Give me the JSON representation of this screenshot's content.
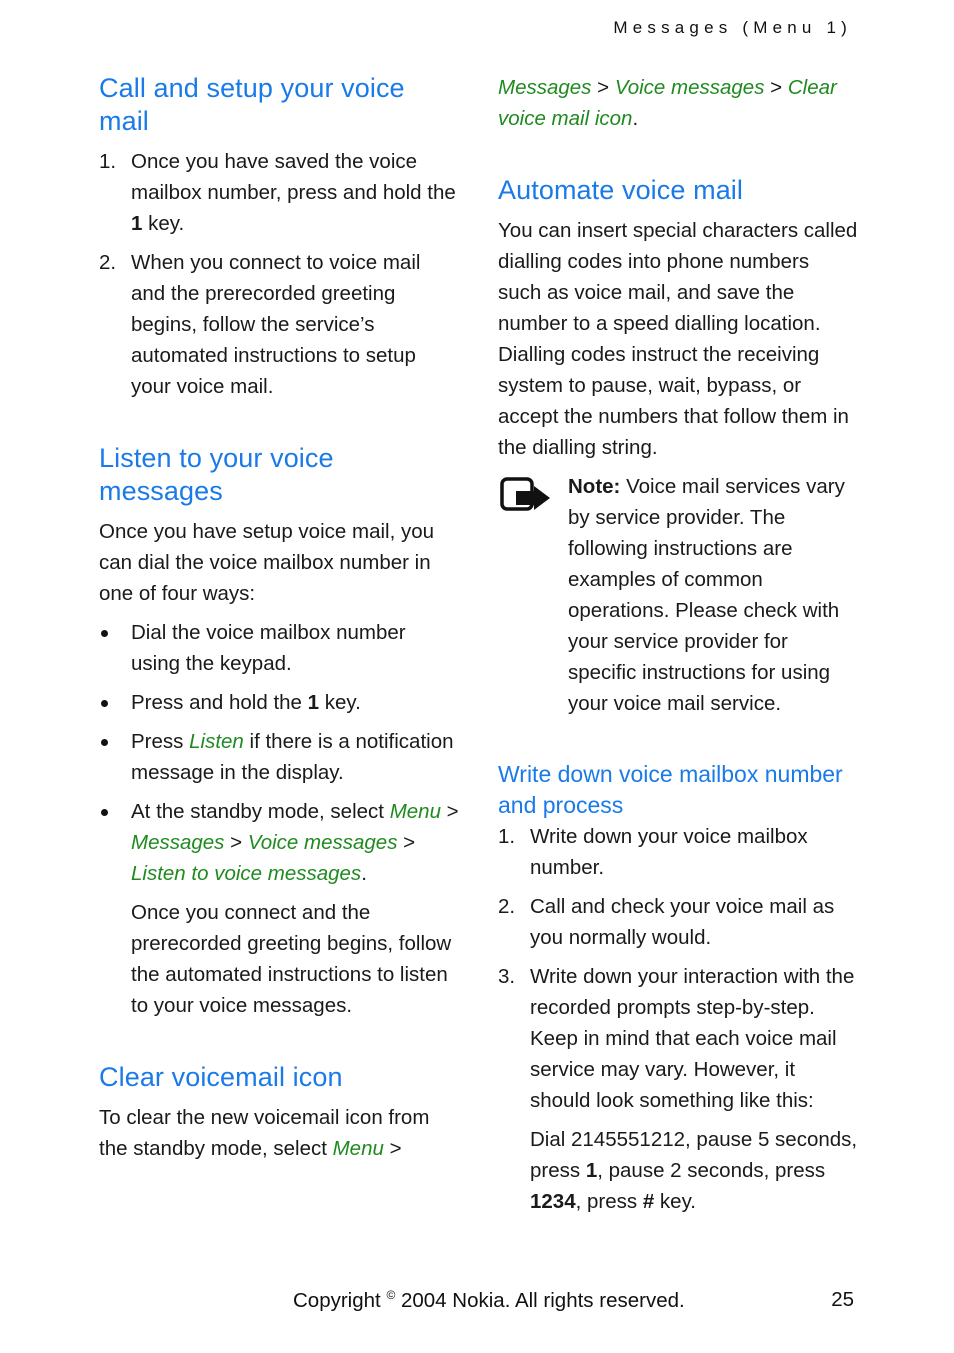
{
  "header": {
    "section": "Messages (Menu 1)"
  },
  "left": {
    "call_setup": {
      "title": "Call and setup your voice mail",
      "steps": [
        {
          "num": "1.",
          "pre": "Once you have saved the voice mailbox number, press and hold the ",
          "bold": "1",
          "post": " key."
        },
        {
          "num": "2.",
          "text": "When you connect to voice mail and the prerecorded greeting begins, follow the service’s automated instructions to setup your voice mail."
        }
      ]
    },
    "listen": {
      "title": "Listen to your voice messages",
      "intro": "Once you have setup voice mail, you can dial the voice mailbox number in one of four ways:",
      "bullets": {
        "b1": "Dial the voice mailbox number using the keypad.",
        "b2_pre": "Press and hold the ",
        "b2_bold": "1",
        "b2_post": " key.",
        "b3_pre": "Press ",
        "b3_link": "Listen",
        "b3_post": " if there is a notification message in the display.",
        "b4_pre": "At the standby mode, select ",
        "b4_path": [
          "Menu",
          "Messages",
          "Voice messages",
          "Listen to voice messages"
        ],
        "b4_sep": " > ",
        "b4_end": ".",
        "b4_follow": "Once you connect and the prerecorded greeting begins, follow the automated instructions to listen to your voice messages."
      }
    },
    "clear": {
      "title": "Clear voicemail icon",
      "text_pre": "To clear the new voicemail icon from the standby mode, select ",
      "path_first": "Menu",
      "sep": " > "
    }
  },
  "right": {
    "clear_cont": {
      "path": [
        "Messages",
        "Voice messages",
        "Clear voice mail icon"
      ],
      "sep": " > ",
      "end": "."
    },
    "automate": {
      "title": "Automate voice mail",
      "body": "You can insert special characters called dialling codes into phone numbers such as voice mail, and save the number to a speed dialling location. Dialling codes instruct the receiving system to pause, wait, bypass, or accept the numbers that follow them in the dialling string.",
      "note_label": "Note:",
      "note_text": " Voice mail services vary by service provider. The following instructions are examples of common operations. Please check with your service provider for specific instructions for using your voice mail service."
    },
    "write_down": {
      "title": "Write down voice mailbox number and process",
      "steps": [
        {
          "num": "1.",
          "text": "Write down your voice mailbox number."
        },
        {
          "num": "2.",
          "text": "Call and check your voice mail as you normally would."
        },
        {
          "num": "3.",
          "text": "Write down your interaction with the recorded prompts step-by-step. Keep in mind that each voice mail service may vary. However, it should look something like this:"
        }
      ],
      "example": {
        "p1": "Dial 2145551212, pause 5 seconds, press ",
        "b1": "1",
        "p2": ", pause 2 seconds, press ",
        "b2": "1234",
        "p3": ", press ",
        "b3": "#",
        "p4": " key."
      }
    }
  },
  "footer": {
    "copyright_pre": "Copyright ",
    "copyright_sym": "©",
    "copyright_post": " 2004 Nokia. All rights reserved.",
    "page": "25"
  },
  "colors": {
    "heading": "#1a7ae8",
    "menu_link": "#1f8a1f",
    "text": "#1a1a1a"
  }
}
